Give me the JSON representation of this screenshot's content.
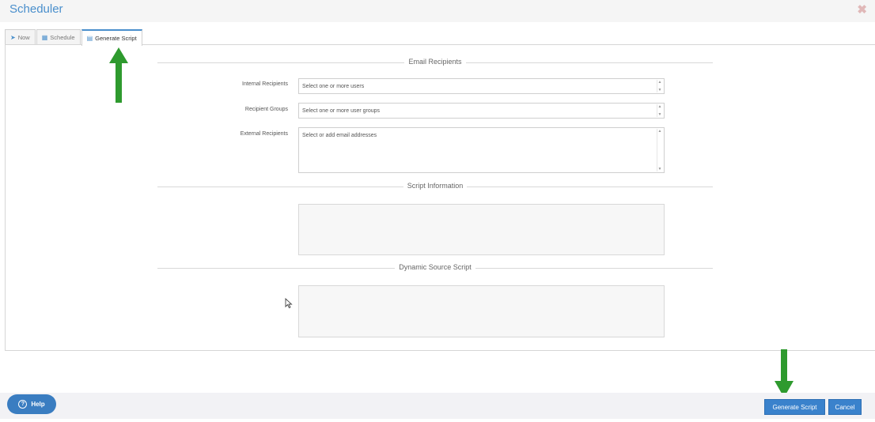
{
  "window": {
    "title": "Scheduler"
  },
  "tabs": [
    {
      "label": "Now",
      "icon": "paper-plane-icon"
    },
    {
      "label": "Schedule",
      "icon": "calendar-icon"
    },
    {
      "label": "Generate Script",
      "icon": "script-icon"
    }
  ],
  "sections": {
    "email": "Email Recipients",
    "script_info": "Script Information",
    "dynamic": "Dynamic Source Script"
  },
  "fields": {
    "internal": {
      "label": "Internal Recipients",
      "placeholder": "Select one or more users"
    },
    "groups": {
      "label": "Recipient Groups",
      "placeholder": "Select one or more user groups"
    },
    "external": {
      "label": "External Recipients",
      "placeholder": "Select or add email addresses"
    }
  },
  "footer": {
    "help_label": "Help",
    "generate_label": "Generate Script",
    "cancel_label": "Cancel"
  },
  "colors": {
    "accent": "#4a8fcc",
    "button": "#3a82cc",
    "arrow": "#2e9a2e"
  }
}
